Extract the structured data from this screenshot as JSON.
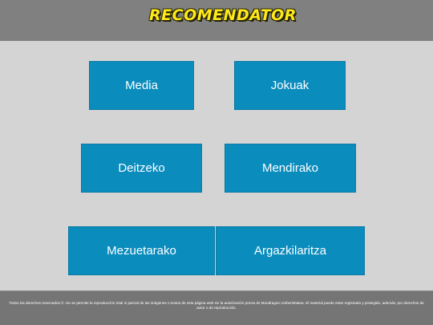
{
  "header": {
    "logo_text": "RECOMENDATOR",
    "background": "#808080",
    "logo_color": "#ffe81c"
  },
  "tiles": [
    {
      "label": "Media"
    },
    {
      "label": "Jokuak"
    },
    {
      "label": "Deitzeko"
    },
    {
      "label": "Mendirako"
    },
    {
      "label": "Mezuetarako"
    },
    {
      "label": "Argazkilaritza"
    }
  ],
  "tile_color": "#0a8cbd",
  "page_background": "#d4d4d4",
  "footer": {
    "text": "Todos los derechos reservados ©. No se permite la reproducción total ni parcial de las imágenes o textos de esta página web sin la autorización previa de Mondragon Unibertsitatea. El material puede estar registrado y protegido, además, por derechos de autor o de reproducción."
  }
}
